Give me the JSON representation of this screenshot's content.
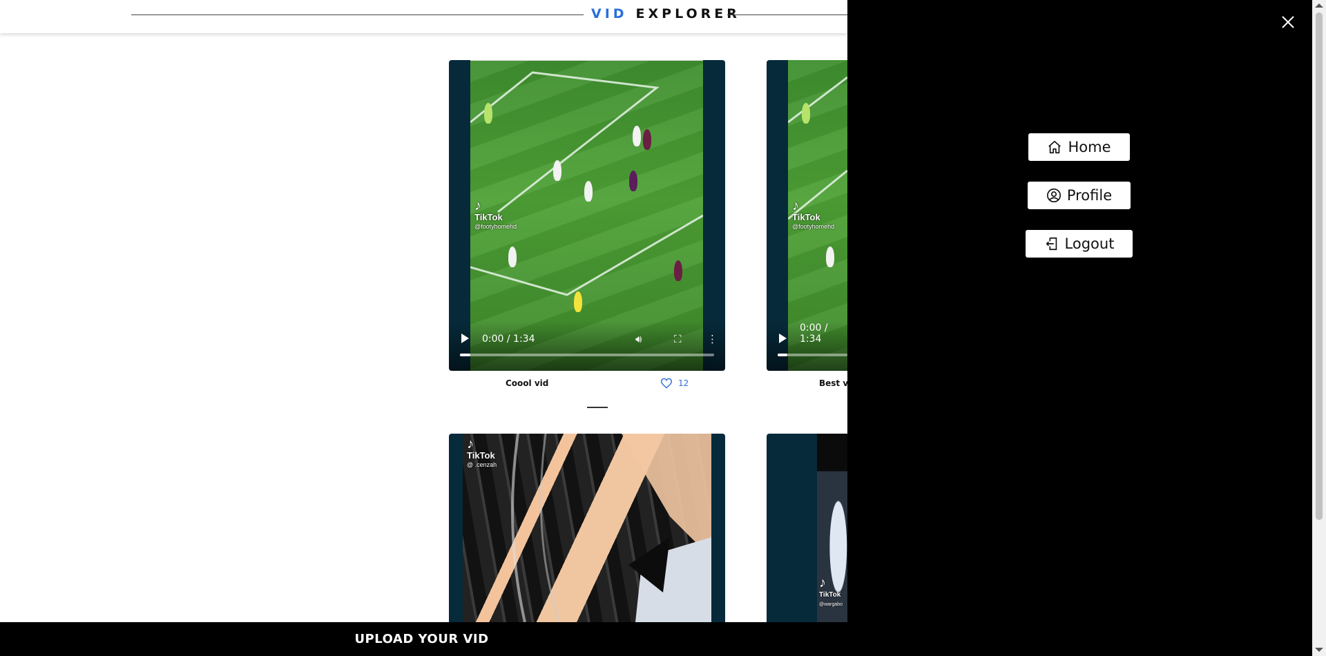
{
  "header": {
    "logo_vid": "VID",
    "logo_explorer": "EXPLORER"
  },
  "videos": [
    {
      "time": "0:00 / 1:34",
      "caption": "Coool vid",
      "likes": "12",
      "watermark_name": "TikTok",
      "watermark_handle": "@footyhomehd"
    },
    {
      "time": "0:00 / 1:34",
      "caption": "Best vi",
      "watermark_name": "TikTok",
      "watermark_handle": "@footyhomehd"
    },
    {
      "watermark_name": "TikTok",
      "watermark_handle": "@ .cenzah"
    },
    {
      "watermark_name": "TikTok",
      "watermark_handle": "@wargabo"
    }
  ],
  "upload": {
    "label": "UPLOAD YOUR VID"
  },
  "menu": {
    "home": "Home",
    "profile": "Profile",
    "logout": "Logout"
  },
  "icons": {
    "close": "close-icon",
    "home": "home-icon",
    "profile": "profile-icon",
    "logout": "logout-icon",
    "heart": "heart-icon"
  },
  "colors": {
    "accent": "#2a6fdb",
    "card_bg": "#062a3a",
    "menu_bg": "#000000"
  }
}
